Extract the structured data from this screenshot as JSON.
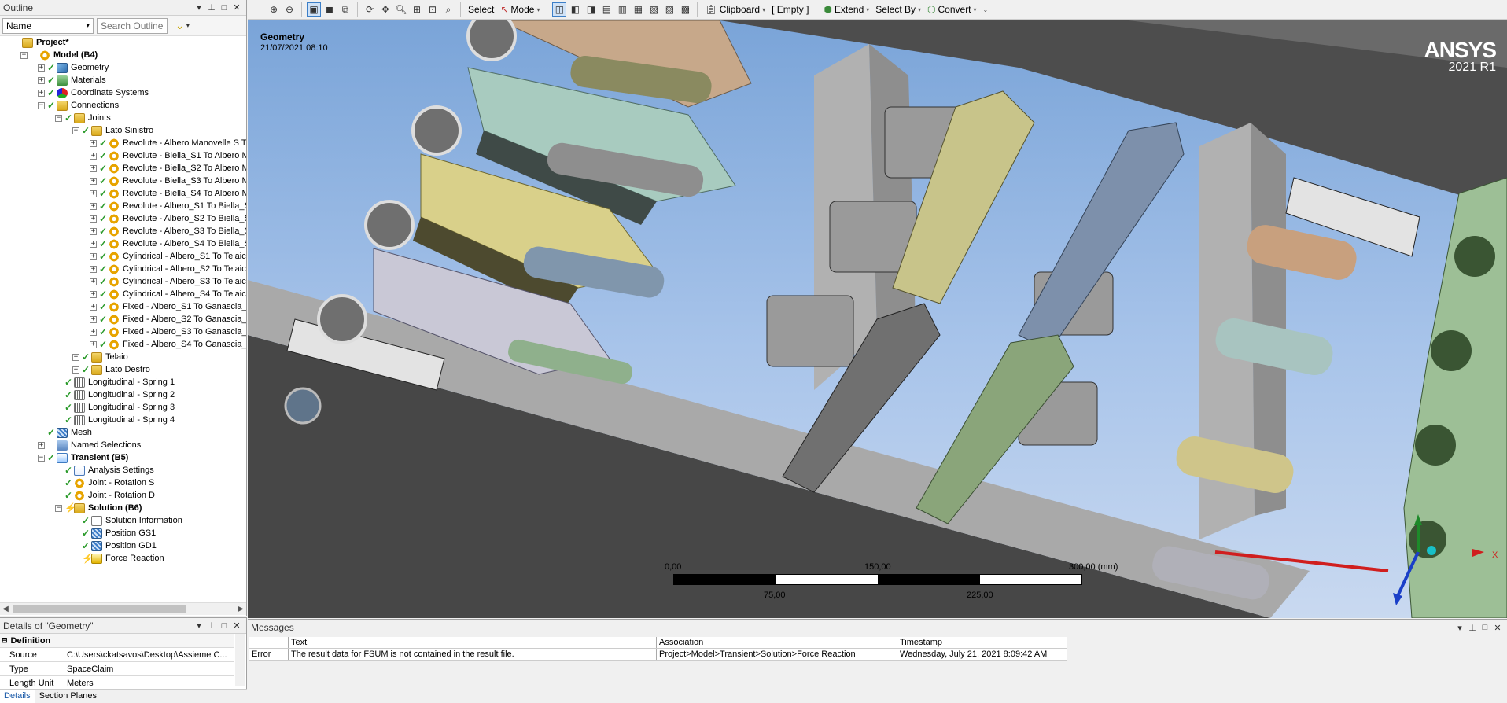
{
  "outline": {
    "title": "Outline",
    "name_select": "Name",
    "search_placeholder": "Search Outline",
    "tree": [
      {
        "label": "Project*",
        "level": 0,
        "icon": "folder",
        "bold": true,
        "expander": "",
        "check": ""
      },
      {
        "label": "Model (B4)",
        "level": 1,
        "icon": "gear",
        "bold": true,
        "expander": "−",
        "check": ""
      },
      {
        "label": "Geometry",
        "level": 2,
        "icon": "geom",
        "bold": false,
        "expander": "+",
        "check": "✓"
      },
      {
        "label": "Materials",
        "level": 2,
        "icon": "mat",
        "bold": false,
        "expander": "+",
        "check": "✓"
      },
      {
        "label": "Coordinate Systems",
        "level": 2,
        "icon": "coord",
        "bold": false,
        "expander": "+",
        "check": "✓"
      },
      {
        "label": "Connections",
        "level": 2,
        "icon": "folder",
        "bold": false,
        "expander": "−",
        "check": "✓"
      },
      {
        "label": "Joints",
        "level": 3,
        "icon": "folder",
        "bold": false,
        "expander": "−",
        "check": "✓"
      },
      {
        "label": "Lato Sinistro",
        "level": 4,
        "icon": "folder",
        "bold": false,
        "expander": "−",
        "check": "✓"
      },
      {
        "label": "Revolute - Albero Manovelle S T",
        "level": 5,
        "icon": "gear",
        "bold": false,
        "expander": "+",
        "check": "✓"
      },
      {
        "label": "Revolute - Biella_S1 To Albero M",
        "level": 5,
        "icon": "gear",
        "bold": false,
        "expander": "+",
        "check": "✓"
      },
      {
        "label": "Revolute - Biella_S2 To Albero M",
        "level": 5,
        "icon": "gear",
        "bold": false,
        "expander": "+",
        "check": "✓"
      },
      {
        "label": "Revolute - Biella_S3 To Albero M",
        "level": 5,
        "icon": "gear",
        "bold": false,
        "expander": "+",
        "check": "✓"
      },
      {
        "label": "Revolute - Biella_S4 To Albero M",
        "level": 5,
        "icon": "gear",
        "bold": false,
        "expander": "+",
        "check": "✓"
      },
      {
        "label": "Revolute - Albero_S1 To Biella_S",
        "level": 5,
        "icon": "gear",
        "bold": false,
        "expander": "+",
        "check": "✓"
      },
      {
        "label": "Revolute - Albero_S2 To Biella_S",
        "level": 5,
        "icon": "gear",
        "bold": false,
        "expander": "+",
        "check": "✓"
      },
      {
        "label": "Revolute - Albero_S3 To Biella_S",
        "level": 5,
        "icon": "gear",
        "bold": false,
        "expander": "+",
        "check": "✓"
      },
      {
        "label": "Revolute - Albero_S4 To Biella_S",
        "level": 5,
        "icon": "gear",
        "bold": false,
        "expander": "+",
        "check": "✓"
      },
      {
        "label": "Cylindrical - Albero_S1 To Telaic",
        "level": 5,
        "icon": "gear",
        "bold": false,
        "expander": "+",
        "check": "✓"
      },
      {
        "label": "Cylindrical - Albero_S2 To Telaic",
        "level": 5,
        "icon": "gear",
        "bold": false,
        "expander": "+",
        "check": "✓"
      },
      {
        "label": "Cylindrical - Albero_S3 To Telaic",
        "level": 5,
        "icon": "gear",
        "bold": false,
        "expander": "+",
        "check": "✓"
      },
      {
        "label": "Cylindrical - Albero_S4 To Telaic",
        "level": 5,
        "icon": "gear",
        "bold": false,
        "expander": "+",
        "check": "✓"
      },
      {
        "label": "Fixed - Albero_S1 To Ganascia_",
        "level": 5,
        "icon": "gear",
        "bold": false,
        "expander": "+",
        "check": "✓"
      },
      {
        "label": "Fixed - Albero_S2 To Ganascia_",
        "level": 5,
        "icon": "gear",
        "bold": false,
        "expander": "+",
        "check": "✓"
      },
      {
        "label": "Fixed - Albero_S3 To Ganascia_",
        "level": 5,
        "icon": "gear",
        "bold": false,
        "expander": "+",
        "check": "✓"
      },
      {
        "label": "Fixed - Albero_S4 To Ganascia_",
        "level": 5,
        "icon": "gear",
        "bold": false,
        "expander": "+",
        "check": "✓"
      },
      {
        "label": "Telaio",
        "level": 4,
        "icon": "folder",
        "bold": false,
        "expander": "+",
        "check": "✓"
      },
      {
        "label": "Lato Destro",
        "level": 4,
        "icon": "folder",
        "bold": false,
        "expander": "+",
        "check": "✓"
      },
      {
        "label": "Longitudinal - Spring 1",
        "level": 3,
        "icon": "spring",
        "bold": false,
        "expander": "",
        "check": "✓"
      },
      {
        "label": "Longitudinal - Spring 2",
        "level": 3,
        "icon": "spring",
        "bold": false,
        "expander": "",
        "check": "✓"
      },
      {
        "label": "Longitudinal - Spring 3",
        "level": 3,
        "icon": "spring",
        "bold": false,
        "expander": "",
        "check": "✓"
      },
      {
        "label": "Longitudinal - Spring 4",
        "level": 3,
        "icon": "spring",
        "bold": false,
        "expander": "",
        "check": "✓"
      },
      {
        "label": "Mesh",
        "level": 2,
        "icon": "mesh",
        "bold": false,
        "expander": "",
        "check": "✓"
      },
      {
        "label": "Named Selections",
        "level": 2,
        "icon": "named",
        "bold": false,
        "expander": "+",
        "check": ""
      },
      {
        "label": "Transient (B5)",
        "level": 2,
        "icon": "trans",
        "bold": true,
        "expander": "−",
        "check": "✓"
      },
      {
        "label": "Analysis Settings",
        "level": 3,
        "icon": "chart",
        "bold": false,
        "expander": "",
        "check": "✓"
      },
      {
        "label": "Joint - Rotation S",
        "level": 3,
        "icon": "gear",
        "bold": false,
        "expander": "",
        "check": "✓"
      },
      {
        "label": "Joint - Rotation D",
        "level": 3,
        "icon": "gear",
        "bold": false,
        "expander": "",
        "check": "✓"
      },
      {
        "label": "Solution (B6)",
        "level": 3,
        "icon": "folder",
        "bold": true,
        "expander": "−",
        "check": "⚡"
      },
      {
        "label": "Solution Information",
        "level": 4,
        "icon": "doc",
        "bold": false,
        "expander": "",
        "check": "✓"
      },
      {
        "label": "Position GS1",
        "level": 4,
        "icon": "mesh",
        "bold": false,
        "expander": "",
        "check": "✓"
      },
      {
        "label": "Position GD1",
        "level": 4,
        "icon": "mesh",
        "bold": false,
        "expander": "",
        "check": "✓"
      },
      {
        "label": "Force Reaction",
        "level": 4,
        "icon": "bolt",
        "bold": false,
        "expander": "",
        "check": "⚡"
      }
    ]
  },
  "details": {
    "title": "Details of \"Geometry\"",
    "section": "Definition",
    "rows": [
      {
        "key": "Source",
        "value": "C:\\Users\\ckatsavos\\Desktop\\Assieme C..."
      },
      {
        "key": "Type",
        "value": "SpaceClaim"
      },
      {
        "key": "Length Unit",
        "value": "Meters"
      }
    ],
    "tabs": [
      "Details",
      "Section Planes"
    ]
  },
  "toolbar": {
    "select_label": "Select",
    "mode_label": "Mode",
    "clipboard_label": "Clipboard",
    "empty_label": "[ Empty ]",
    "extend_label": "Extend",
    "select_by_label": "Select By",
    "convert_label": "Convert"
  },
  "viewport": {
    "title": "Geometry",
    "date": "21/07/2021 08:10",
    "brand": "ANSYS",
    "version": "2021 R1",
    "scale": {
      "top_labels": [
        "0,00",
        "150,00",
        "300,00 (mm)"
      ],
      "bottom_labels": [
        "75,00",
        "225,00"
      ]
    },
    "axis_x_label": "X"
  },
  "messages": {
    "title": "Messages",
    "columns": [
      "",
      "Text",
      "Association",
      "Timestamp"
    ],
    "rows": [
      {
        "type": "Error",
        "text": "The result data for FSUM is not contained in the result file.",
        "association": "Project>Model>Transient>Solution>Force Reaction",
        "timestamp": "Wednesday, July 21, 2021 8:09:42 AM"
      }
    ]
  },
  "colors": {
    "accent": "#3c7fc8",
    "check_green": "#2a9a2a",
    "warning_yellow": "#e0a800",
    "viewport_top": "#7aa4d8",
    "viewport_bottom": "#c9d9f0",
    "frame_gray": "#a9a9a9",
    "frame_dark": "#4a4a4a"
  }
}
